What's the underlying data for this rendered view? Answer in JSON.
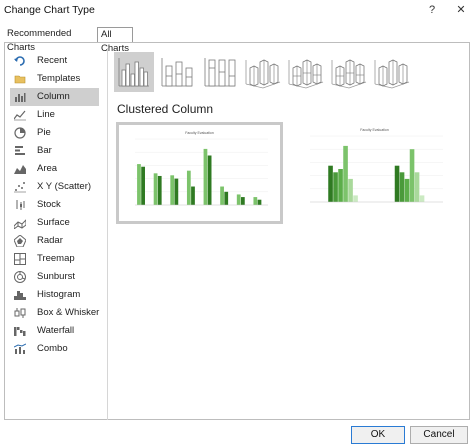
{
  "window": {
    "title": "Change Chart Type",
    "help_glyph": "?",
    "close_glyph": "✕"
  },
  "tabs": [
    {
      "label": "Recommended Charts",
      "active": false
    },
    {
      "label": "All Charts",
      "active": true
    }
  ],
  "sidebar": {
    "items": [
      {
        "label": "Recent",
        "icon": "recent-icon",
        "selected": false
      },
      {
        "label": "Templates",
        "icon": "folder-icon",
        "selected": false
      },
      {
        "label": "Column",
        "icon": "column-chart-icon",
        "selected": true
      },
      {
        "label": "Line",
        "icon": "line-chart-icon",
        "selected": false
      },
      {
        "label": "Pie",
        "icon": "pie-chart-icon",
        "selected": false
      },
      {
        "label": "Bar",
        "icon": "bar-chart-icon",
        "selected": false
      },
      {
        "label": "Area",
        "icon": "area-chart-icon",
        "selected": false
      },
      {
        "label": "X Y (Scatter)",
        "icon": "scatter-chart-icon",
        "selected": false
      },
      {
        "label": "Stock",
        "icon": "stock-chart-icon",
        "selected": false
      },
      {
        "label": "Surface",
        "icon": "surface-chart-icon",
        "selected": false
      },
      {
        "label": "Radar",
        "icon": "radar-chart-icon",
        "selected": false
      },
      {
        "label": "Treemap",
        "icon": "treemap-chart-icon",
        "selected": false
      },
      {
        "label": "Sunburst",
        "icon": "sunburst-chart-icon",
        "selected": false
      },
      {
        "label": "Histogram",
        "icon": "histogram-chart-icon",
        "selected": false
      },
      {
        "label": "Box & Whisker",
        "icon": "box-whisker-chart-icon",
        "selected": false
      },
      {
        "label": "Waterfall",
        "icon": "waterfall-chart-icon",
        "selected": false
      },
      {
        "label": "Combo",
        "icon": "combo-chart-icon",
        "selected": false
      }
    ]
  },
  "subtypes": [
    {
      "name": "clustered-column",
      "selected": true
    },
    {
      "name": "stacked-column",
      "selected": false
    },
    {
      "name": "100-stacked-column",
      "selected": false
    },
    {
      "name": "3d-clustered-column",
      "selected": false
    },
    {
      "name": "3d-stacked-column",
      "selected": false
    },
    {
      "name": "3d-100-stacked-column",
      "selected": false
    },
    {
      "name": "3d-column",
      "selected": false
    }
  ],
  "main": {
    "heading": "Clustered Column"
  },
  "previews": [
    {
      "title": "Faculty Evaluation",
      "selected": true,
      "bar_colors": [
        "#7cc36b",
        "#2f7a22",
        "#a9d99b"
      ],
      "groups": [
        [
          0.62,
          0.58,
          0.0
        ],
        [
          0.48,
          0.44,
          0.0
        ],
        [
          0.45,
          0.4,
          0.0
        ],
        [
          0.52,
          0.28,
          0.0
        ],
        [
          0.85,
          0.75,
          0.0
        ],
        [
          0.28,
          0.2,
          0.0
        ],
        [
          0.16,
          0.12,
          0.0
        ],
        [
          0.12,
          0.08,
          0.0
        ]
      ]
    },
    {
      "title": "Faculty Evaluation",
      "selected": false,
      "bar_colors": [
        "#2f7a22",
        "#4a9a3a",
        "#5cae4a",
        "#7cc36b",
        "#a9d99b",
        "#cbeac2"
      ],
      "groups": [
        [
          0.55,
          0.45,
          0.5,
          0.85,
          0.35,
          0.1
        ],
        [
          0.55,
          0.45,
          0.35,
          0.8,
          0.45,
          0.1
        ]
      ]
    }
  ],
  "buttons": {
    "ok": "OK",
    "cancel": "Cancel"
  },
  "colors": {
    "selected_bg": "#cfcfcf",
    "chart_green": "#7cc36b",
    "dark_green": "#2f7a22",
    "icon_blue": "#2b6cb0",
    "accent_border": "#2a7bd4"
  }
}
